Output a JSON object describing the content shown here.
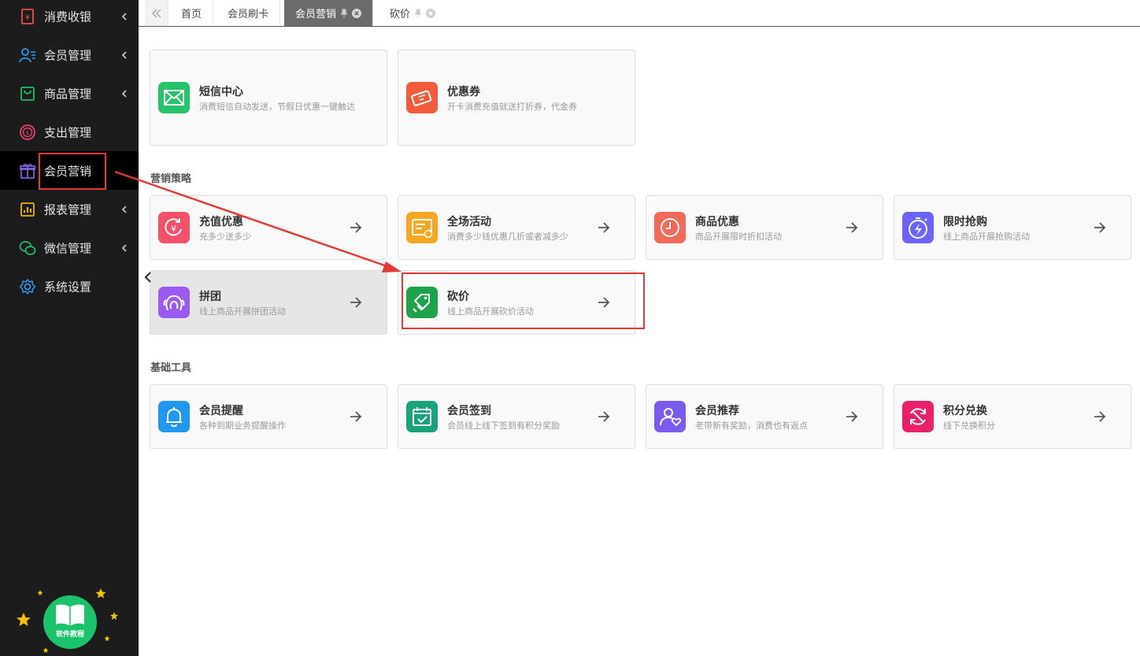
{
  "sidebar": {
    "items": [
      {
        "label": "消费收银",
        "icon": "cashier-icon",
        "color": "#e94f4f",
        "chevron": true
      },
      {
        "label": "会员管理",
        "icon": "members-icon",
        "color": "#2f9bf0",
        "chevron": true
      },
      {
        "label": "商品管理",
        "icon": "goods-icon",
        "color": "#19c26b",
        "chevron": true
      },
      {
        "label": "支出管理",
        "icon": "expense-icon",
        "color": "#e8436d",
        "chevron": false
      },
      {
        "label": "会员营销",
        "icon": "gift-icon",
        "color": "#8a66e8",
        "chevron": false
      },
      {
        "label": "报表管理",
        "icon": "report-icon",
        "color": "#f0b400",
        "chevron": true
      },
      {
        "label": "微信管理",
        "icon": "wechat-icon",
        "color": "#19c26b",
        "chevron": true
      },
      {
        "label": "系统设置",
        "icon": "gear-icon",
        "color": "#2f9bf0",
        "chevron": false
      }
    ],
    "tutorial_label": "软件教程"
  },
  "tabs": [
    {
      "label": "首页"
    },
    {
      "label": "会员刷卡"
    },
    {
      "label": "会员营销"
    },
    {
      "label": "砍价"
    }
  ],
  "top_cards": [
    {
      "title": "短信中心",
      "desc": "消费短信自动发送，节假日优惠一键触达",
      "icon": "mail-icon",
      "color": "#27c26c"
    },
    {
      "title": "优惠券",
      "desc": "开卡消费充值就送打折券，代金券",
      "icon": "coupon-icon",
      "color": "#f35b3c"
    }
  ],
  "strategy": {
    "title": "营销策略",
    "cards": [
      {
        "title": "充值优惠",
        "desc": "充多少送多少",
        "icon": "recharge-icon",
        "color": "#f45069"
      },
      {
        "title": "全场活动",
        "desc": "消费多少钱优惠几折或者减多少",
        "icon": "storewide-icon",
        "color": "#f5a623"
      },
      {
        "title": "商品优惠",
        "desc": "商品开展限时折扣活动",
        "icon": "clock-icon",
        "color": "#f36a5a"
      },
      {
        "title": "限时抢购",
        "desc": "线上商品开展抢购活动",
        "icon": "flash-sale-icon",
        "color": "#6c63ff"
      },
      {
        "title": "拼团",
        "desc": "线上商品开展拼团活动",
        "icon": "group-buy-icon",
        "color": "#9b59f0"
      },
      {
        "title": "砍价",
        "desc": "线上商品开展砍价活动",
        "icon": "bargain-icon",
        "color": "#1fa34a"
      }
    ]
  },
  "tools": {
    "title": "基础工具",
    "cards": [
      {
        "title": "会员提醒",
        "desc": "各种到期业务提醒操作",
        "icon": "bell-icon",
        "color": "#2196f3"
      },
      {
        "title": "会员签到",
        "desc": "会员线上线下签到有积分奖励",
        "icon": "checkin-icon",
        "color": "#1aa27c"
      },
      {
        "title": "会员推荐",
        "desc": "老带新有奖励，消费也有返点",
        "icon": "referral-icon",
        "color": "#7a5af0"
      },
      {
        "title": "积分兑换",
        "desc": "线下兑换积分",
        "icon": "points-exchange-icon",
        "color": "#ec1f6b"
      }
    ]
  },
  "colors": {
    "sidebar_bg": "#1c1c1c",
    "active_tab": "#6b6b6b",
    "annotation": "#e53935"
  }
}
